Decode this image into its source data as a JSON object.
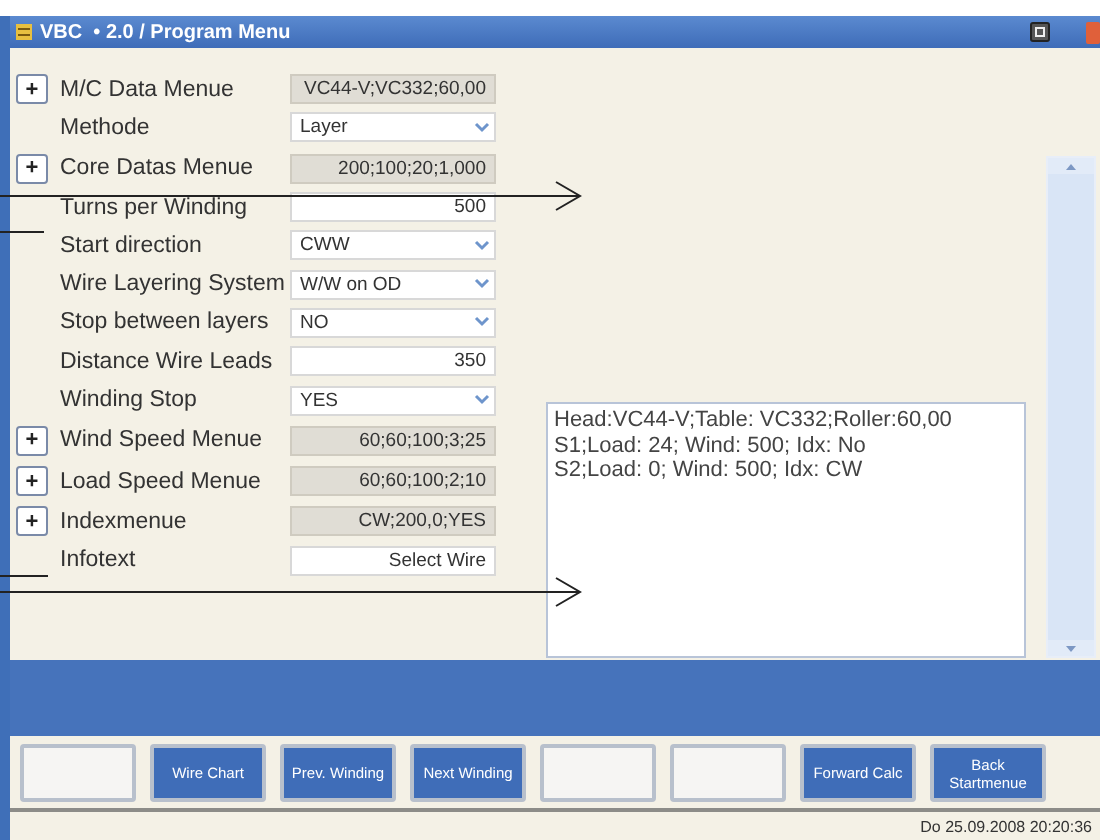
{
  "window": {
    "title": "VBC  • 2.0 / Program Menu"
  },
  "form": [
    {
      "kind": "menu",
      "expand": "+",
      "label": "M/C Data Menue",
      "value": "VC44-V;VC332;60,00"
    },
    {
      "kind": "select",
      "label": "Methode",
      "value": "Layer"
    },
    {
      "kind": "menu",
      "expand": "+",
      "label": "Core Datas Menue",
      "value": "200;100;20;1,000"
    },
    {
      "kind": "input",
      "label": "Turns per Winding",
      "value": "500"
    },
    {
      "kind": "select",
      "label": "Start direction",
      "value": "CWW"
    },
    {
      "kind": "select",
      "label": "Wire Layering System",
      "value": "W/W on OD"
    },
    {
      "kind": "select",
      "label": "Stop between layers",
      "value": "NO"
    },
    {
      "kind": "input",
      "label": "Distance Wire Leads",
      "value": "350"
    },
    {
      "kind": "select",
      "label": "Winding Stop",
      "value": "YES"
    },
    {
      "kind": "menu",
      "expand": "+",
      "label": "Wind Speed Menue",
      "value": "60;60;100;3;25"
    },
    {
      "kind": "menu",
      "expand": "+",
      "label": "Load Speed Menue",
      "value": "60;60;100;2;10"
    },
    {
      "kind": "menu",
      "expand": "+",
      "label": "Indexmenue",
      "value": "CW;200,0;YES"
    },
    {
      "kind": "input",
      "label": "Infotext",
      "value": "Select Wire"
    }
  ],
  "summary": [
    "Head:VC44-V;Table: VC332;Roller:60,00",
    "S1;Load: 24; Wind: 500; Idx: No",
    "S2;Load: 0; Wind: 500; Idx: CW"
  ],
  "buttons": [
    {
      "kind": "blank"
    },
    {
      "kind": "action",
      "label": "Wire Chart"
    },
    {
      "kind": "action",
      "label": "Prev. Winding"
    },
    {
      "kind": "action",
      "label": "Next Winding"
    },
    {
      "kind": "blank"
    },
    {
      "kind": "blank"
    },
    {
      "kind": "action",
      "label": "Forward Calc"
    },
    {
      "kind": "action",
      "label": "Back\nStartmenue"
    }
  ],
  "status_bar": {
    "datetime": "Do 25.09.2008 20:20:36"
  }
}
